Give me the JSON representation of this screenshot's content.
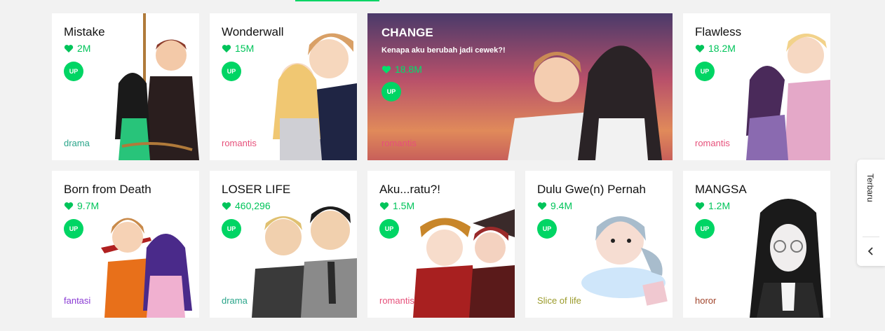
{
  "colors": {
    "accent": "#00d564",
    "likes": "#00c45a"
  },
  "cards": [
    {
      "title": "Mistake",
      "likes": "2M",
      "badge": "UP",
      "genre": "drama",
      "genre_color": "#2aa58a"
    },
    {
      "title": "Wonderwall",
      "likes": "15M",
      "badge": "UP",
      "genre": "romantis",
      "genre_color": "#e6507a"
    },
    {
      "title": "CHANGE",
      "subtitle": "Kenapa aku berubah jadi cewek?!",
      "likes": "18.8M",
      "badge": "UP",
      "genre": "romantis",
      "genre_color": "#e6507a"
    },
    {
      "title": "Flawless",
      "likes": "18.2M",
      "badge": "UP",
      "genre": "romantis",
      "genre_color": "#e6507a"
    },
    {
      "title": "Born from Death",
      "likes": "9.7M",
      "badge": "UP",
      "genre": "fantasi",
      "genre_color": "#8a3bd4"
    },
    {
      "title": "LOSER LIFE",
      "likes": "460,296",
      "badge": "UP",
      "genre": "drama",
      "genre_color": "#2aa58a"
    },
    {
      "title": "Aku...ratu?!",
      "likes": "1.5M",
      "badge": "UP",
      "genre": "romantis",
      "genre_color": "#e6507a"
    },
    {
      "title": "Dulu Gwe(n) Pernah",
      "likes": "9.4M",
      "badge": "UP",
      "genre": "Slice of life",
      "genre_color": "#9a9a2a"
    },
    {
      "title": "MANGSA",
      "likes": "1.2M",
      "badge": "UP",
      "genre": "horor",
      "genre_color": "#a0432a"
    }
  ],
  "side_tab": {
    "label": "Terbaru",
    "icon": "chevron-left-icon"
  },
  "icons": {
    "heart": "heart-icon"
  }
}
